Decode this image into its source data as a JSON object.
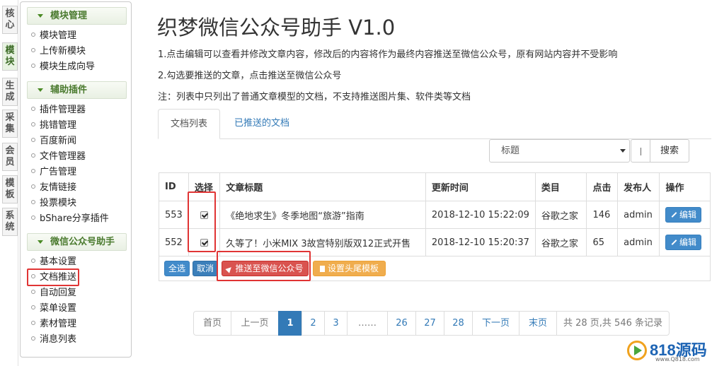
{
  "vertical_tabs": [
    "核心",
    "模块",
    "生成",
    "采集",
    "会员",
    "模板",
    "系统"
  ],
  "sidebar": {
    "sections": [
      {
        "title": "模块管理",
        "items": [
          "模块管理",
          "上传新模块",
          "模块生成向导"
        ]
      },
      {
        "title": "辅助插件",
        "items": [
          "插件管理器",
          "挑错管理",
          "百度新闻",
          "文件管理器",
          "广告管理",
          "友情链接",
          "投票模块",
          "bShare分享插件"
        ]
      },
      {
        "title": "微信公众号助手",
        "items": [
          "基本设置",
          "文档推送",
          "自动回复",
          "菜单设置",
          "素材管理",
          "消息列表"
        ]
      }
    ]
  },
  "page": {
    "title": "织梦微信公众号助手 V1.0",
    "intro": [
      "1.点击编辑可以查看并修改文章内容，修改后的内容将作为最终内容推送至微信公众号，原有网站内容并不受影响",
      "2.勾选要推送的文章，点击推送至微信公众号",
      "注：列表中只列出了普通文章模型的文档，不支持推送图片集、软件类等文档"
    ]
  },
  "tabs": [
    "文档列表",
    "已推送的文档"
  ],
  "search": {
    "select_value": "标题",
    "button": "搜索"
  },
  "table": {
    "headers": [
      "ID",
      "选择",
      "文章标题",
      "更新时间",
      "类目",
      "点击",
      "发布人",
      "操作"
    ],
    "rows": [
      {
        "id": "553",
        "checked": true,
        "title": "《绝地求生》冬季地图“旅游”指南",
        "time": "2018-12-10 15:22:09",
        "category": "谷歌之家",
        "clicks": "146",
        "author": "admin",
        "action": "编辑"
      },
      {
        "id": "552",
        "checked": true,
        "title": "久等了！小米MIX 3故宫特别版双12正式开售",
        "time": "2018-12-10 15:20:37",
        "category": "谷歌之家",
        "clicks": "65",
        "author": "admin",
        "action": "编辑"
      }
    ]
  },
  "actions": {
    "select_all": "全选",
    "cancel": "取消",
    "push": "推送至微信公众号",
    "tail_template": "设置头尾模板"
  },
  "pagination": {
    "first": "首页",
    "prev": "上一页",
    "pages": [
      "1",
      "2",
      "3",
      "……",
      "26",
      "27",
      "28"
    ],
    "current": "1",
    "next": "下一页",
    "last": "末页",
    "summary": "共 28 页,共 546 条记录"
  },
  "watermark": {
    "brand": "818源码",
    "url": "www.Q818.com"
  },
  "colors": {
    "primary": "#428bca",
    "danger": "#d9534f",
    "warning": "#f0ad4e",
    "highlight": "#e03434",
    "sidebar_green": "#4a7a2e"
  }
}
